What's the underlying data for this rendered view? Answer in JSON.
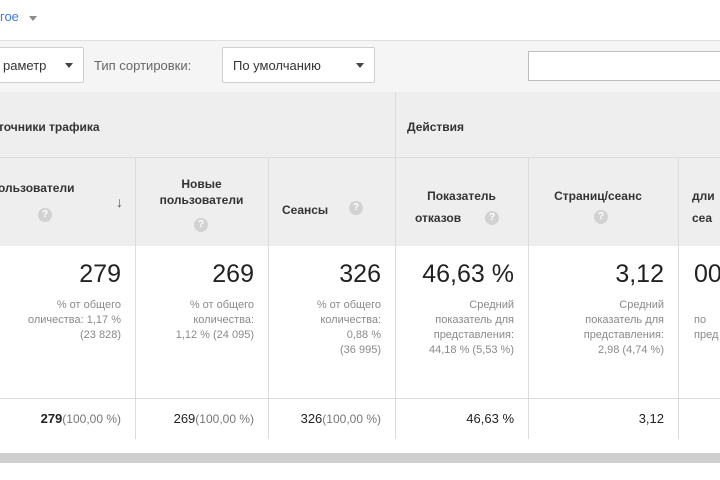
{
  "top": {
    "link_text": "гое"
  },
  "controls": {
    "param_dropdown": "раметр",
    "sort_label": "Тип сортировки:",
    "sort_dropdown": "По умолчанию",
    "search_value": ""
  },
  "groups": {
    "traffic": "точники трафика",
    "actions": "Действия"
  },
  "headers": {
    "users": "ользователи",
    "new_users_1": "Новые",
    "new_users_2": "пользователи",
    "sessions": "Сеансы",
    "bounce_1": "Показатель",
    "bounce_2": "отказов",
    "pages": "Страниц/сеанс",
    "duration_1": "дли",
    "duration_2": "сеа"
  },
  "metrics": {
    "users": {
      "value": "279",
      "sub1": "% от общего",
      "sub2": "оличества: 1,17 %",
      "sub3": "(23 828)"
    },
    "new_users": {
      "value": "269",
      "sub1": "% от общего",
      "sub2": "количества:",
      "sub3": "1,12 % (24 095)"
    },
    "sessions": {
      "value": "326",
      "sub1": "% от общего",
      "sub2": "количества:",
      "sub3": "0,88 %",
      "sub4": "(36 995)"
    },
    "bounce": {
      "value": "46,63 %",
      "sub1": "Средний",
      "sub2": "показатель для",
      "sub3": "представления:",
      "sub4": "44,18 % (5,53 %)"
    },
    "pages": {
      "value": "3,12",
      "sub1": "Средний",
      "sub2": "показатель для",
      "sub3": "представления:",
      "sub4": "2,98 (4,74 %)"
    },
    "duration": {
      "value": "00",
      "sub1": "",
      "sub2": "по",
      "sub3": "пред"
    }
  },
  "row": {
    "users": "279",
    "users_pct": "(100,00 %)",
    "new_users": "269",
    "new_users_pct": "(100,00 %)",
    "sessions": "326",
    "sessions_pct": "(100,00 %)",
    "bounce": "46,63 %",
    "pages": "3,12"
  },
  "icons": {
    "help": "?",
    "sort": "↓"
  }
}
